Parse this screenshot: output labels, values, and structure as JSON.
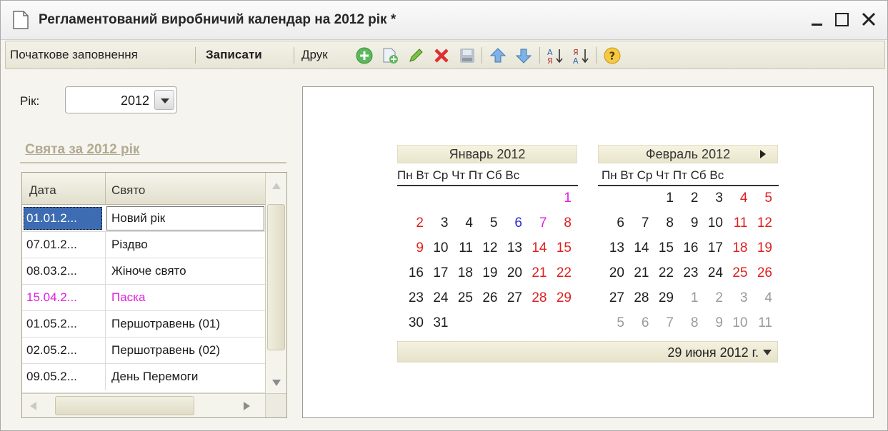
{
  "window": {
    "title": "Регламентований виробничий календар на 2012 рік *"
  },
  "toolbar": {
    "initial_fill": "Початкове заповнення",
    "save": "Записати",
    "print": "Друк",
    "icons": [
      "add-icon",
      "copy-icon",
      "edit-icon",
      "delete-icon",
      "post-icon",
      "move-up-icon",
      "move-down-icon",
      "sort-asc-icon",
      "sort-desc-icon",
      "help-icon"
    ]
  },
  "year": {
    "label": "Рік:",
    "value": "2012"
  },
  "holidays": {
    "title": "Свята за 2012 рік",
    "columns": {
      "date": "Дата",
      "name": "Свято"
    },
    "rows": [
      {
        "date": "01.01.2...",
        "name": "Новий рік"
      },
      {
        "date": "07.01.2...",
        "name": "Різдво"
      },
      {
        "date": "08.03.2...",
        "name": "Жіноче свято"
      },
      {
        "date": "15.04.2...",
        "name": "Паска"
      },
      {
        "date": "01.05.2...",
        "name": "Першотравень (01)"
      },
      {
        "date": "02.05.2...",
        "name": "Першотравень (02)"
      },
      {
        "date": "09.05.2...",
        "name": "День Перемоги"
      }
    ]
  },
  "calendar": {
    "weekdays": "Пн Вт Ср Чт Пт Сб Вс",
    "january": {
      "title": "Январь 2012",
      "weeks": [
        [
          "",
          "",
          "",
          "",
          "",
          "",
          "1"
        ],
        [
          "2",
          "3",
          "4",
          "5",
          "6",
          "7",
          "8"
        ],
        [
          "9",
          "10",
          "11",
          "12",
          "13",
          "14",
          "15"
        ],
        [
          "16",
          "17",
          "18",
          "19",
          "20",
          "21",
          "22"
        ],
        [
          "23",
          "24",
          "25",
          "26",
          "27",
          "28",
          "29"
        ],
        [
          "30",
          "31",
          "",
          "",
          "",
          "",
          ""
        ]
      ]
    },
    "february": {
      "title": "Февраль 2012",
      "weeks": [
        [
          "",
          "",
          "1",
          "2",
          "3",
          "4",
          "5"
        ],
        [
          "6",
          "7",
          "8",
          "9",
          "10",
          "11",
          "12"
        ],
        [
          "13",
          "14",
          "15",
          "16",
          "17",
          "18",
          "19"
        ],
        [
          "20",
          "21",
          "22",
          "23",
          "24",
          "25",
          "26"
        ],
        [
          "27",
          "28",
          "29",
          "1",
          "2",
          "3",
          "4"
        ],
        [
          "5",
          "6",
          "7",
          "8",
          "9",
          "10",
          "11"
        ]
      ]
    },
    "current_date": "29 июня 2012 г.",
    "colors": {
      "weekend": "#e02020",
      "blue": "#2a2ad0",
      "pink": "#e020e0",
      "other_month": "#9a9a9a"
    }
  }
}
